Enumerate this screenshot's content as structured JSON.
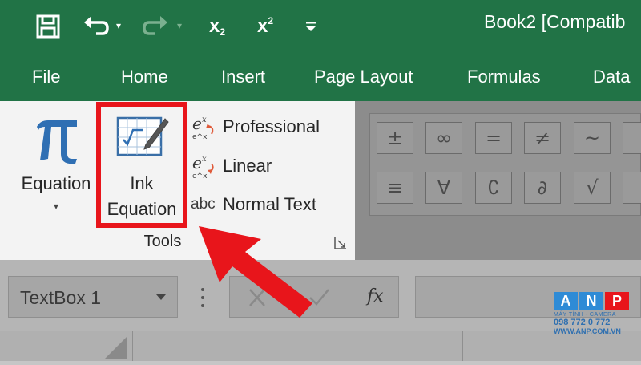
{
  "title_bar": {
    "title": "Book2  [Compatib",
    "icons": [
      "save-icon",
      "undo-icon",
      "redo-icon",
      "subscript-icon",
      "superscript-icon",
      "customize-toolbar-icon"
    ],
    "subscript_label": "x",
    "subscript_sub": "2",
    "superscript_label": "x",
    "superscript_sup": "2"
  },
  "tabs": [
    "File",
    "Home",
    "Insert",
    "Page Layout",
    "Formulas",
    "Data"
  ],
  "ribbon": {
    "equation_label": "Equation",
    "ink_line1": "Ink",
    "ink_line2": "Equation",
    "tools": [
      "Professional",
      "Linear",
      "Normal Text"
    ],
    "normal_text_icon": "abc",
    "group_label": "Tools",
    "symbols_row1": [
      "±",
      "∞",
      "=",
      "≠",
      "~"
    ],
    "symbols_row2": [
      "≡",
      "∀",
      "∁",
      "∂",
      "√"
    ]
  },
  "formula_bar": {
    "name_box": "TextBox 1",
    "fx_label": "fx"
  },
  "watermark": {
    "letters": [
      "A",
      "N",
      "P"
    ],
    "line1": "MÁY TÍNH - CAMERA",
    "phone": "098 772 0 772",
    "site": "WWW.ANP.COM.VN"
  },
  "colors": {
    "excel_green": "#217346",
    "highlight_red": "#e8151b",
    "equation_blue": "#2f6fb3"
  }
}
